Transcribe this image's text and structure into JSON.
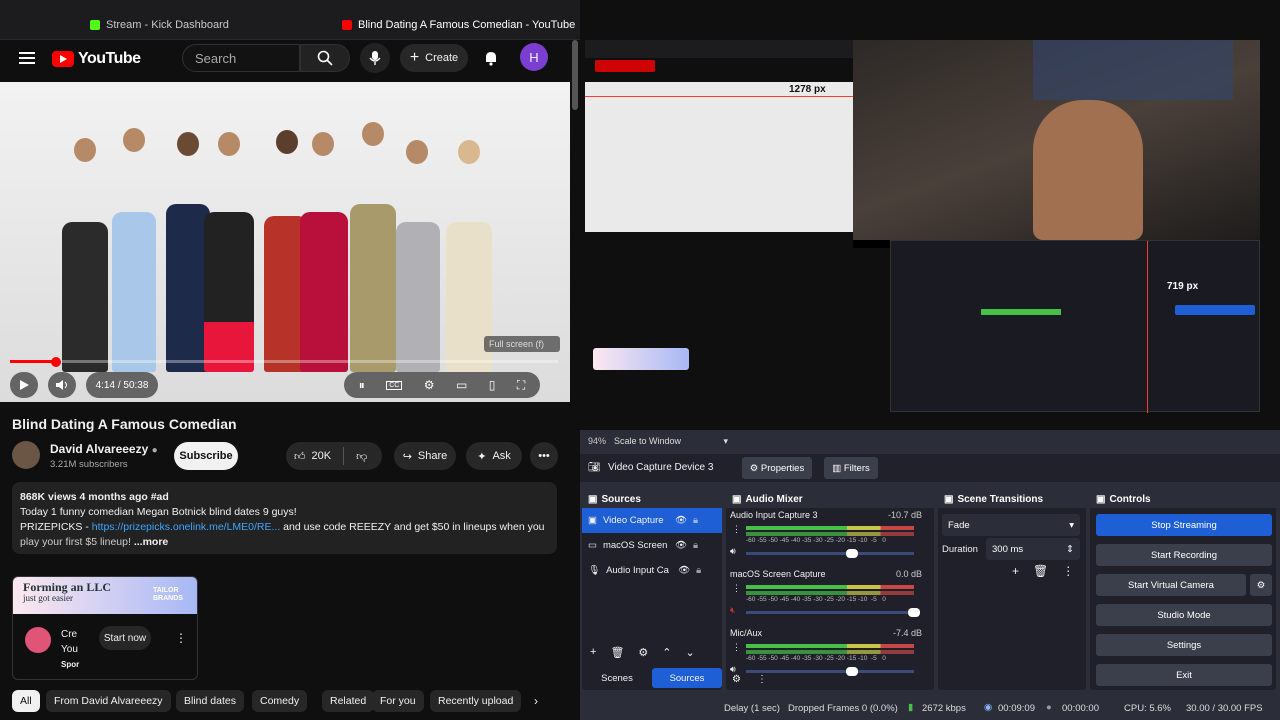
{
  "browser": {
    "tab1": "Stream - Kick Dashboard",
    "tab2": "Blind Dating A Famous Comedian - YouTube"
  },
  "youtube": {
    "logo": "YouTube",
    "search_placeholder": "Search",
    "create_label": "Create",
    "avatar_letter": "H",
    "video": {
      "time": "4:14 / 50:38",
      "fullscreen_tip": "Full screen (f)",
      "progress_fraction": 0.084
    },
    "title": "Blind Dating A Famous Comedian",
    "channel": {
      "name": "David Alvareeezy",
      "subscribers": "3.21M subscribers",
      "subscribe_label": "Subscribe"
    },
    "actions": {
      "likes": "20K",
      "share": "Share",
      "ask": "Ask"
    },
    "description": {
      "meta": "868K views  4 months ago  #ad",
      "line1": "Today 1 funny comedian Megan Botnick blind dates 9 guys!",
      "line2_prefix": "PRIZEPICKS - ",
      "link": "https://prizepicks.onelink.me/LME0/RE...",
      "line2_suffix": " and use code REEEZY and get $50 in lineups when you",
      "line3": "play your first $5 lineup! ",
      "more": "...more"
    },
    "ad": {
      "banner_line1": "Forming an LLC",
      "banner_line2": "just got easier",
      "brand": "TAILOR BRANDS",
      "text1": "Cre",
      "text2": "You",
      "sponsored": "Spor",
      "cta": "Start now"
    },
    "chips": [
      "All",
      "From David Alvareeezy",
      "Blind dates",
      "Comedy",
      "Related",
      "For you",
      "Recently upload"
    ]
  },
  "preview": {
    "size_top": "1278 px",
    "size_right": "719 px"
  },
  "obs": {
    "zoom_label": "94%",
    "scale_label": "Scale to Window",
    "source_name": "Video Capture Device 3",
    "properties": "Properties",
    "filters": "Filters",
    "sources_header": "Sources",
    "sources": [
      "Video Capture",
      "macOS Screen",
      "Audio Input Ca"
    ],
    "mixer_header": "Audio Mixer",
    "mixer": [
      {
        "name": "Audio Input Capture 3",
        "db": "-10.7 dB"
      },
      {
        "name": "macOS Screen Capture",
        "db": "0.0 dB"
      },
      {
        "name": "Mic/Aux",
        "db": "-7.4 dB"
      }
    ],
    "scale_ticks": "-60 -55 -50 -45 -40 -35 -30 -25 -20 -15 -10  -5   0",
    "transitions_header": "Scene Transitions",
    "transition": "Fade",
    "duration_label": "Duration",
    "duration_value": "300 ms",
    "controls_header": "Controls",
    "controls": {
      "stop": "Stop Streaming",
      "record": "Start Recording",
      "virtual": "Start Virtual Camera",
      "studio": "Studio Mode",
      "settings": "Settings",
      "exit": "Exit"
    },
    "tabs": {
      "scenes": "Scenes",
      "sources": "Sources"
    },
    "status": {
      "delay": "Delay (1 sec)",
      "dropped": "Dropped Frames 0 (0.0%)",
      "kbps": "2672 kbps",
      "stream_time": "00:09:09",
      "rec_time": "00:00:00",
      "cpu": "CPU: 5.6%",
      "fps": "30.00 / 30.00 FPS"
    }
  }
}
